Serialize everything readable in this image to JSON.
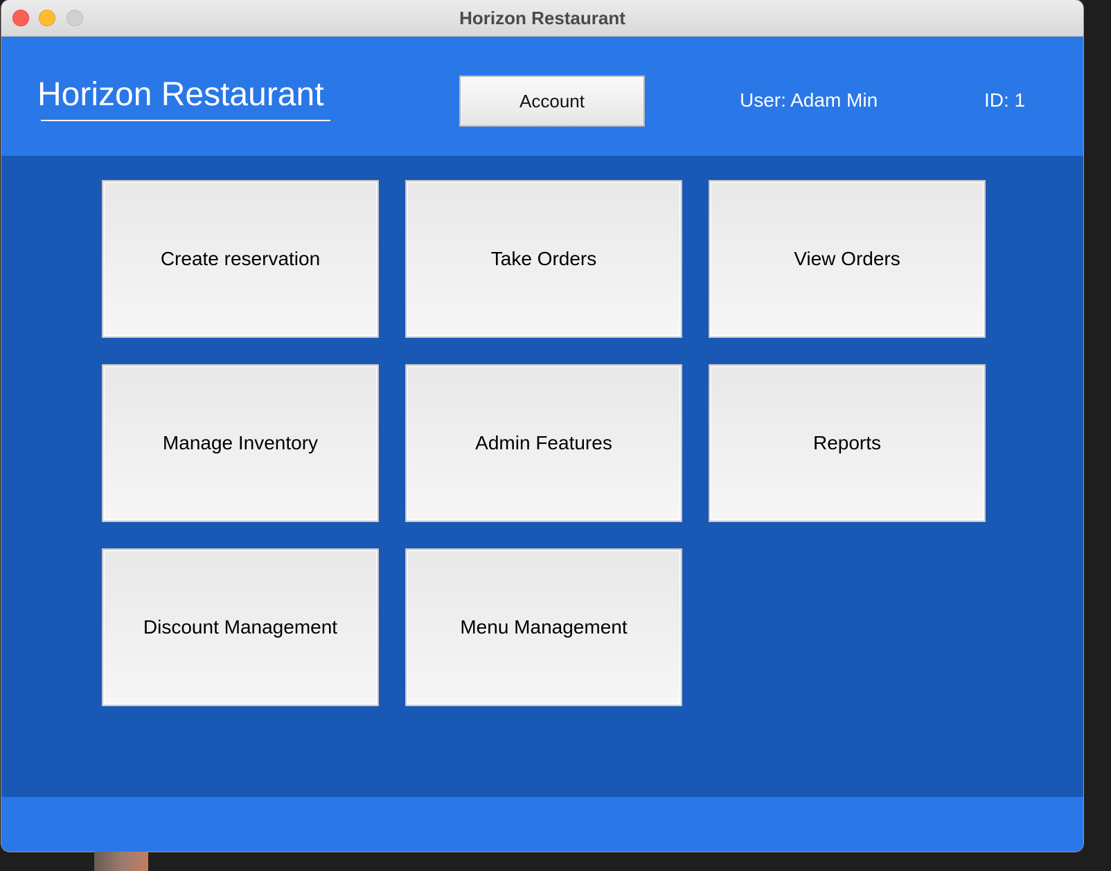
{
  "window": {
    "title": "Horizon Restaurant"
  },
  "header": {
    "app_title": "Horizon Restaurant",
    "account_label": "Account",
    "user_text": "User: Adam Min",
    "id_text": "ID: 1"
  },
  "tiles": [
    {
      "label": "Create reservation"
    },
    {
      "label": "Take Orders"
    },
    {
      "label": "View Orders"
    },
    {
      "label": "Manage Inventory"
    },
    {
      "label": "Admin Features"
    },
    {
      "label": "Reports"
    },
    {
      "label": "Discount Management"
    },
    {
      "label": "Menu Management"
    }
  ],
  "colors": {
    "header_blue": "#2a77e8",
    "body_blue": "#1a58b6",
    "tile_bg": "#f0f0f0"
  },
  "icons": {
    "close": "close-icon",
    "minimize": "minimize-icon",
    "zoom": "zoom-icon"
  }
}
